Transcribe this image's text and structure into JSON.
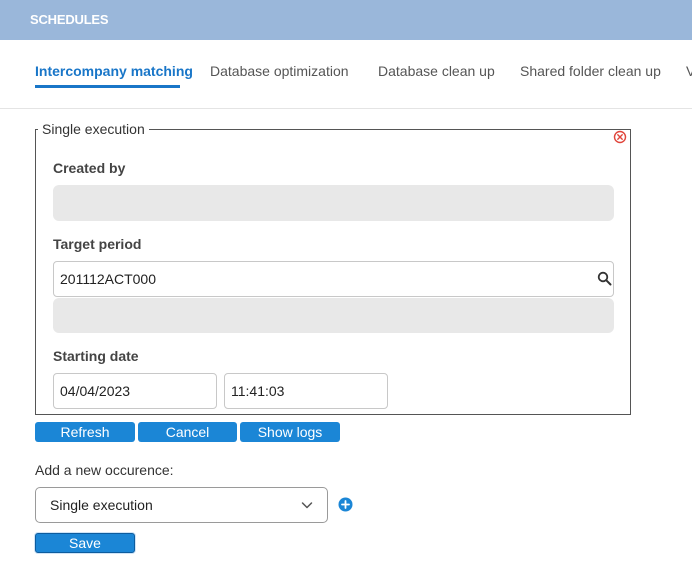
{
  "header": {
    "title": "SCHEDULES"
  },
  "tabs": [
    {
      "label": "Intercompany matching",
      "active": true
    },
    {
      "label": "Database optimization"
    },
    {
      "label": "Database clean up"
    },
    {
      "label": "Shared folder clean up"
    },
    {
      "label": "V"
    }
  ],
  "execution": {
    "legend": "Single execution",
    "created_by_label": "Created by",
    "created_by_value": "",
    "target_period_label": "Target period",
    "target_period_value": "201112ACT000",
    "target_period_description": "",
    "starting_date_label": "Starting date",
    "date_value": "04/04/2023",
    "time_value": "11:41:03"
  },
  "actions": {
    "refresh": "Refresh",
    "cancel": "Cancel",
    "show_logs": "Show logs"
  },
  "new_occurrence": {
    "label": "Add a new occurence:",
    "selected": "Single execution"
  },
  "save_label": "Save",
  "colors": {
    "header_bg": "#9ab7da",
    "accent": "#1976c8",
    "button_bg": "#1b86d6",
    "close_red": "#e0443a"
  },
  "icons": [
    "close-circle-icon",
    "search-icon",
    "chevron-down-icon",
    "plus-circle-icon"
  ]
}
